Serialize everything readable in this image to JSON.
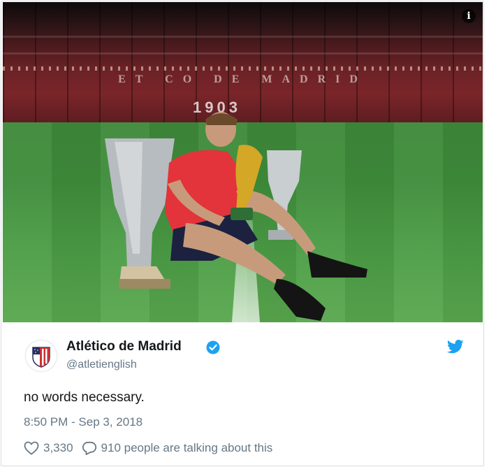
{
  "media": {
    "stadium_lettering": "ET  CO  DE  MADRID",
    "stadium_year": "1903"
  },
  "tweet": {
    "author_name": "Atlético de Madrid",
    "author_handle": "@atletienglish",
    "verified": true,
    "text": "no words necessary.",
    "timestamp": "8:50 PM - Sep 3, 2018",
    "like_count": "3,330",
    "reply_text": "910 people are talking about this"
  },
  "icons": {
    "info": "info-icon",
    "verified": "verified-badge-icon",
    "brand": "twitter-bird-icon",
    "like": "heart-icon",
    "reply": "reply-bubble-icon"
  },
  "colors": {
    "verified_blue": "#1da1f2",
    "twitter_blue": "#1da1f2",
    "text_primary": "#14171a",
    "text_secondary": "#657786",
    "club_red": "#cb3234",
    "club_navy": "#272e61"
  }
}
